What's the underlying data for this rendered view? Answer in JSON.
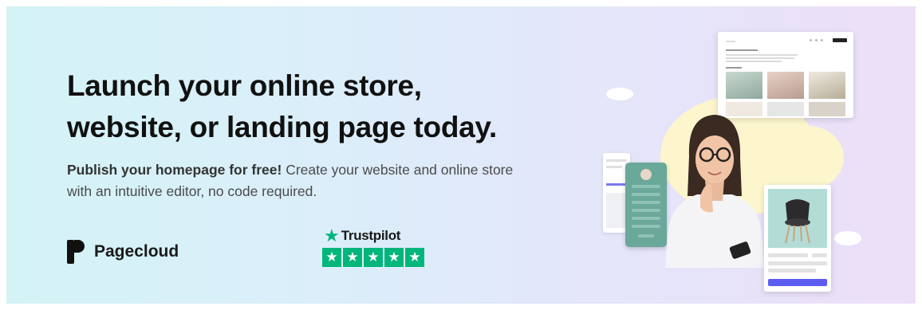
{
  "hero": {
    "headline_line1": "Launch your online store,",
    "headline_line2": "website, or landing page today.",
    "sub_strong": "Publish your homepage for free!",
    "sub_rest": " Create your website and online store with an intuitive editor, no code required."
  },
  "brand": {
    "name": "Pagecloud",
    "logo_icon": "pagecloud-logo-icon"
  },
  "trustpilot": {
    "name": "Trustpilot",
    "rating_stars": 5,
    "star_color": "#00b67a"
  },
  "colors": {
    "headline": "#111111",
    "body_text": "#4a4a4a",
    "gradient_left": "#d4f3f6",
    "gradient_right": "#ecdff8",
    "cta_purple": "#5c5cf0"
  }
}
